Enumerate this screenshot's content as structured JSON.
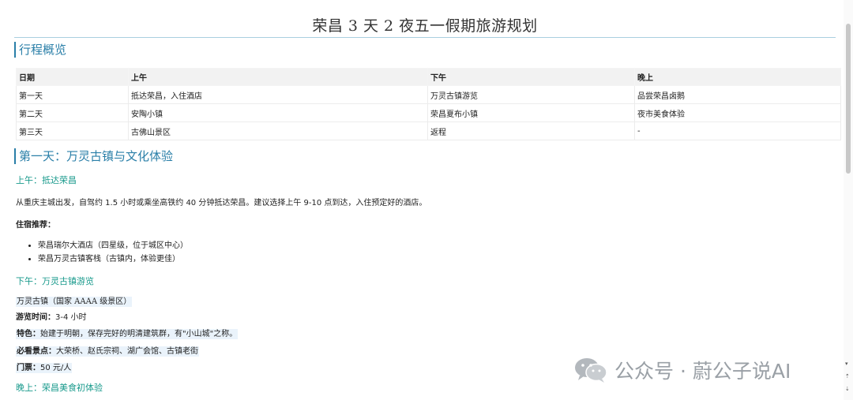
{
  "document": {
    "title": "荣昌 3 天 2 夜五一假期旅游规划"
  },
  "overview": {
    "heading": "行程概览",
    "columns": [
      "日期",
      "上午",
      "下午",
      "晚上"
    ],
    "rows": [
      [
        "第一天",
        "抵达荣昌，入住酒店",
        "万灵古镇游览",
        "品尝荣昌卤鹅"
      ],
      [
        "第二天",
        "安陶小镇",
        "荣昌夏布小镇",
        "夜市美食体验"
      ],
      [
        "第三天",
        "古佛山景区",
        "返程",
        "-"
      ]
    ]
  },
  "day1": {
    "heading": "第一天：万灵古镇与文化体验",
    "morning": {
      "heading": "上午：抵达荣昌",
      "text": "从重庆主城出发，自驾约 1.5 小时或乘坐高铁约 40 分钟抵达荣昌。建议选择上午 9-10 点到达，入住预定好的酒店。",
      "lodging_label": "住宿推荐：",
      "lodging": [
        "荣昌瑞尔大酒店（四星级，位于城区中心）",
        "荣昌万灵古镇客栈（古镇内，体验更佳）"
      ]
    },
    "afternoon": {
      "heading": "下午：万灵古镇游览",
      "site": "万灵古镇（国家 AAAA 级景区）",
      "duration_label": "游览时间：",
      "duration": "3-4 小时",
      "feature_label": "特色：",
      "feature": "始建于明朝，保存完好的明清建筑群，有\"小山城\"之称。",
      "must_see_label": "必看景点：",
      "must_see": "大荣桥、赵氏宗祠、湖广会馆、古镇老街",
      "ticket_label": "门票：",
      "ticket": "50 元/人"
    },
    "evening": {
      "heading": "晚上：荣昌美食初体验"
    }
  },
  "watermark": {
    "text": "公众号 · 蔚公子说AI",
    "icon": "wechat-icon"
  },
  "colors": {
    "heading_blue": "#2a7fa8",
    "subheading_teal": "#199a8c",
    "highlight": "#eaf3fb"
  }
}
